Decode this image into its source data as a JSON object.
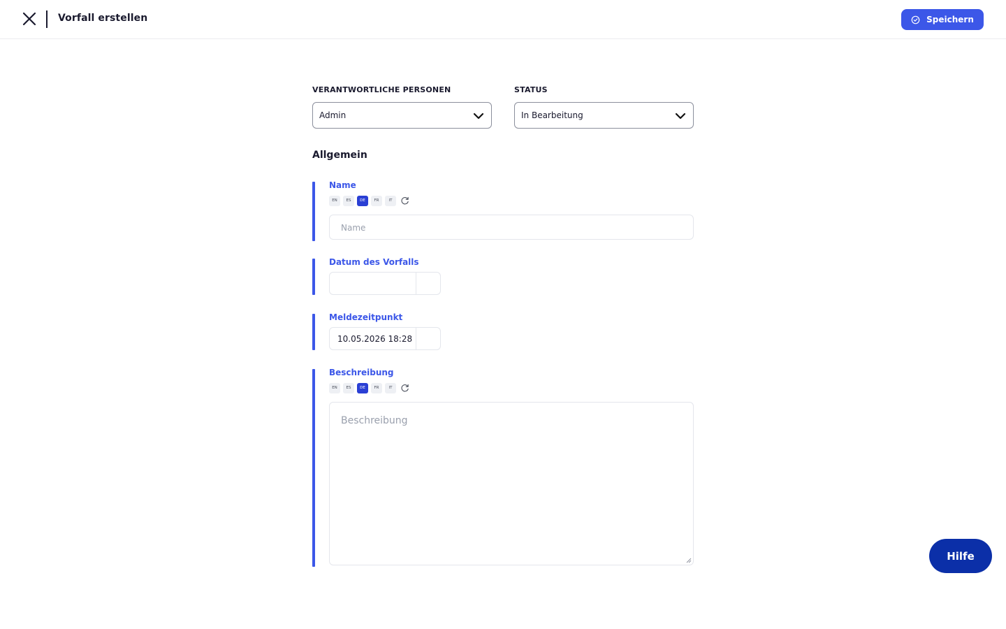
{
  "header": {
    "title": "Vorfall erstellen",
    "save_label": "Speichern"
  },
  "responsible": {
    "label": "VERANTWORTLICHE PERSONEN",
    "value": "Admin"
  },
  "status": {
    "label": "STATUS",
    "value": "In Bearbeitung"
  },
  "section": {
    "title": "Allgemein"
  },
  "languages": [
    "EN",
    "ES",
    "DE",
    "FR",
    "IT"
  ],
  "active_language": "DE",
  "fields": {
    "name": {
      "label": "Name",
      "placeholder": "Name",
      "value": ""
    },
    "incident_date": {
      "label": "Datum des Vorfalls",
      "value": ""
    },
    "report_time": {
      "label": "Meldezeitpunkt",
      "value": "10.05.2026 18:28"
    },
    "description": {
      "label": "Beschreibung",
      "placeholder": "Beschreibung",
      "value": ""
    }
  },
  "help": {
    "label": "Hilfe"
  },
  "colors": {
    "accent": "#3c57e8",
    "active_language": "#2a3fd4",
    "help_button": "#0b2fa8",
    "text": "#1a1a2e"
  },
  "icons": {
    "close": "close-icon",
    "save": "check-circle-icon",
    "dropdown": "chevron-down-icon",
    "reset": "refresh-icon"
  }
}
